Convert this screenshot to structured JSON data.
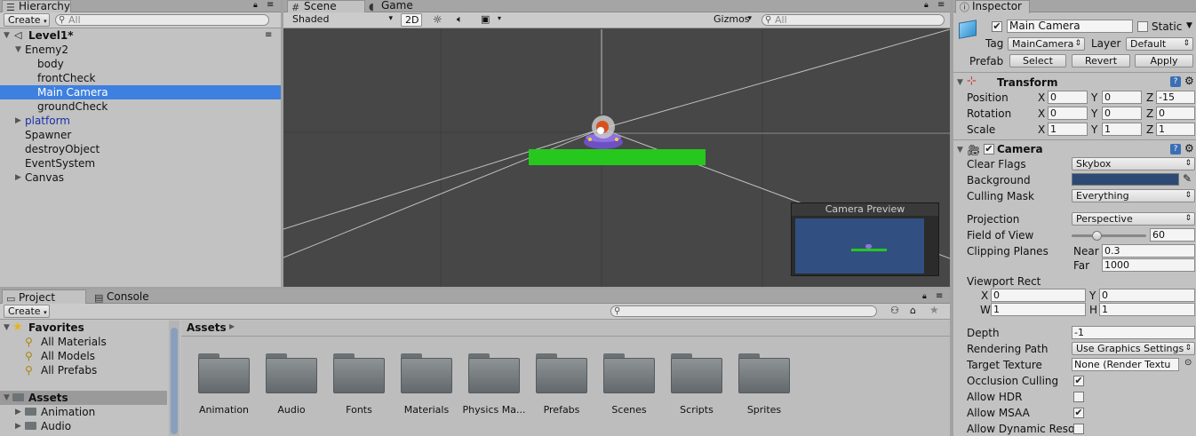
{
  "hierarchy": {
    "tab": "Hierarchy",
    "create": "Create",
    "search_placeholder": "All",
    "scene": "Level1*",
    "items": [
      "Enemy2",
      "body",
      "frontCheck",
      "Main Camera",
      "groundCheck",
      "platform",
      "Spawner",
      "destroyObject",
      "EventSystem",
      "Canvas"
    ]
  },
  "scene_view": {
    "tab_scene": "Scene",
    "tab_game": "Game",
    "shading": "Shaded",
    "mode_2d": "2D",
    "gizmos": "Gizmos",
    "search_placeholder": "All",
    "preview_title": "Camera Preview"
  },
  "project": {
    "tab_project": "Project",
    "tab_console": "Console",
    "create": "Create",
    "favorites": "Favorites",
    "favorite_items": [
      "All Materials",
      "All Models",
      "All Prefabs"
    ],
    "assets": "Assets",
    "asset_tree": [
      "Animation",
      "Audio"
    ],
    "breadcrumb": "Assets",
    "folders": [
      "Animation",
      "Audio",
      "Fonts",
      "Materials",
      "Physics Ma...",
      "Prefabs",
      "Scenes",
      "Scripts",
      "Sprites"
    ]
  },
  "inspector": {
    "tab": "Inspector",
    "object_name": "Main Camera",
    "static_label": "Static",
    "tag_label": "Tag",
    "tag_value": "MainCamera",
    "layer_label": "Layer",
    "layer_value": "Default",
    "prefab_label": "Prefab",
    "prefab_select": "Select",
    "prefab_revert": "Revert",
    "prefab_apply": "Apply",
    "transform": {
      "title": "Transform",
      "position_label": "Position",
      "rotation_label": "Rotation",
      "scale_label": "Scale",
      "x": "X",
      "y": "Y",
      "z": "Z",
      "position": [
        "0",
        "0",
        "-15"
      ],
      "rotation": [
        "0",
        "0",
        "0"
      ],
      "scale": [
        "1",
        "1",
        "1"
      ]
    },
    "camera": {
      "title": "Camera",
      "clear_flags_label": "Clear Flags",
      "clear_flags": "Skybox",
      "background_label": "Background",
      "background_color": "#2c4a73",
      "culling_mask_label": "Culling Mask",
      "culling_mask": "Everything",
      "projection_label": "Projection",
      "projection": "Perspective",
      "fov_label": "Field of View",
      "fov": "60",
      "fov_fraction": 0.33,
      "clipping_label": "Clipping Planes",
      "near_label": "Near",
      "near": "0.3",
      "far_label": "Far",
      "far": "1000",
      "viewport_label": "Viewport Rect",
      "vx_label": "X",
      "vx": "0",
      "vy_label": "Y",
      "vy": "0",
      "vw_label": "W",
      "vw": "1",
      "vh_label": "H",
      "vh": "1",
      "depth_label": "Depth",
      "depth": "-1",
      "rendering_path_label": "Rendering Path",
      "rendering_path": "Use Graphics Settings",
      "target_texture_label": "Target Texture",
      "target_texture": "None (Render Textu",
      "occlusion_label": "Occlusion Culling",
      "occlusion": true,
      "hdr_label": "Allow HDR",
      "hdr": false,
      "msaa_label": "Allow MSAA",
      "msaa": true,
      "dynres_label": "Allow Dynamic Reso",
      "dynres": false
    }
  }
}
